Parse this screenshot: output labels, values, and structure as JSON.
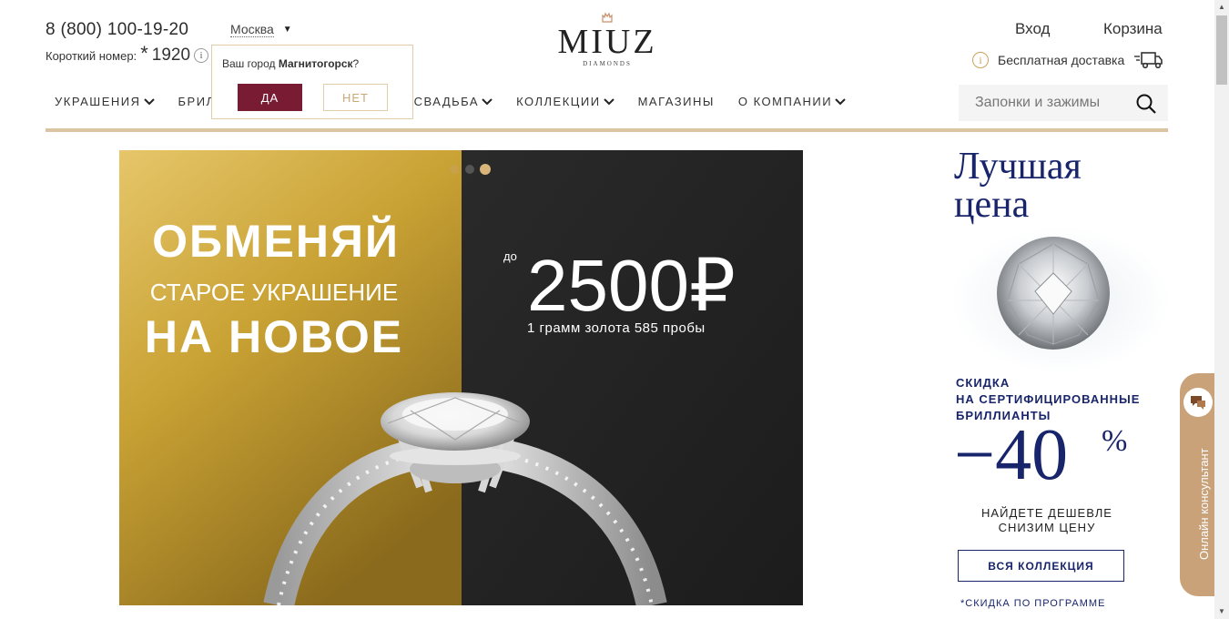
{
  "header": {
    "phone": "8 (800) 100-19-20",
    "short_label": "Короткий номер:",
    "short_star": "*",
    "short_number": "1920",
    "city": "Москва",
    "logo_word": "MIUZ",
    "logo_sub": "DIAMONDS",
    "login": "Вход",
    "cart": "Корзина",
    "delivery": "Бесплатная доставка"
  },
  "nav": {
    "items": [
      "УКРАШЕНИЯ",
      "БРИЛ",
      "СВАДЬБА",
      "КОЛЛЕКЦИИ",
      "МАГАЗИНЫ",
      "О КОМПАНИИ"
    ]
  },
  "search": {
    "placeholder": "Запонки и зажимы"
  },
  "city_popup": {
    "question_prefix": "Ваш город ",
    "city": "Магнитогорск",
    "question_suffix": "?",
    "yes": "ДА",
    "no": "НЕТ"
  },
  "banner": {
    "line1": "ОБМЕНЯЙ",
    "line2": "СТАРОЕ УКРАШЕНИЕ",
    "line3": "НА НОВОЕ",
    "upto": "до",
    "amount": "2500₽",
    "note": "1 грамм золота 585 пробы",
    "slides": 3,
    "active_slide": 3
  },
  "promo": {
    "title_line1": "Лучшая",
    "title_line2": "цена",
    "text_line1": "СКИДКА",
    "text_line2": "НА СЕРТИФИЦИРОВАННЫЕ",
    "text_line3": "БРИЛЛИАНТЫ",
    "percent": "−40",
    "pct_sign": "%",
    "find_line1": "НАЙДЕТЕ ДЕШЕВЛЕ",
    "find_line2": "СНИЗИМ ЦЕНУ",
    "button": "ВСЯ КОЛЛЕКЦИЯ",
    "footnote": "*СКИДКА ПО ПРОГРАММЕ"
  },
  "consultant": {
    "label": "Онлайн консультант"
  },
  "colors": {
    "accent_gold": "#dcc3a2",
    "brand_burgundy": "#7a1b34",
    "promo_navy": "#18256b"
  }
}
